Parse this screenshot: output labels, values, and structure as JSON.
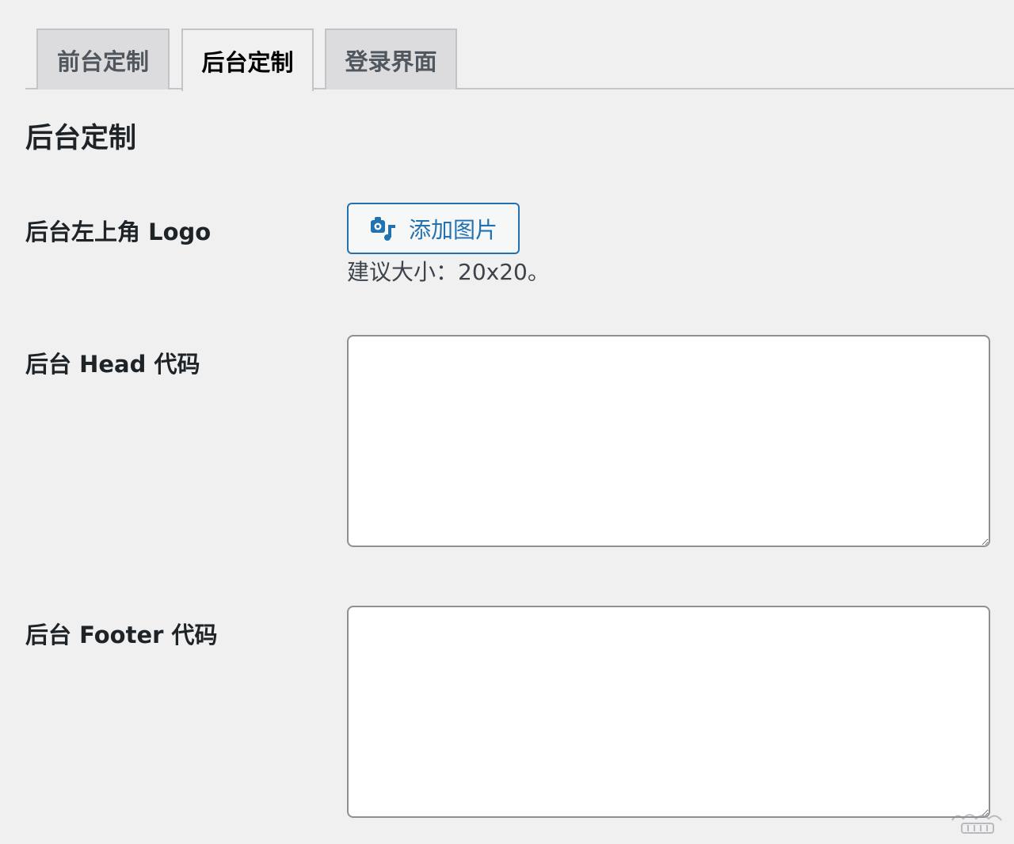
{
  "tabs": [
    {
      "label": "前台定制",
      "active": false
    },
    {
      "label": "后台定制",
      "active": true
    },
    {
      "label": "登录界面",
      "active": false
    }
  ],
  "section": {
    "title": "后台定制"
  },
  "fields": {
    "logo": {
      "label": "后台左上角 Logo",
      "button_label": "添加图片",
      "hint": "建议大小：20x20。"
    },
    "head_code": {
      "label": "后台 Head 代码",
      "value": ""
    },
    "footer_code": {
      "label": "后台 Footer 代码",
      "value": ""
    }
  },
  "icons": {
    "add_image": "media-add-icon",
    "resize": "resize-handle-icon"
  },
  "colors": {
    "accent": "#2271b1",
    "background": "#f0f0f1",
    "border": "#8c8f94"
  }
}
